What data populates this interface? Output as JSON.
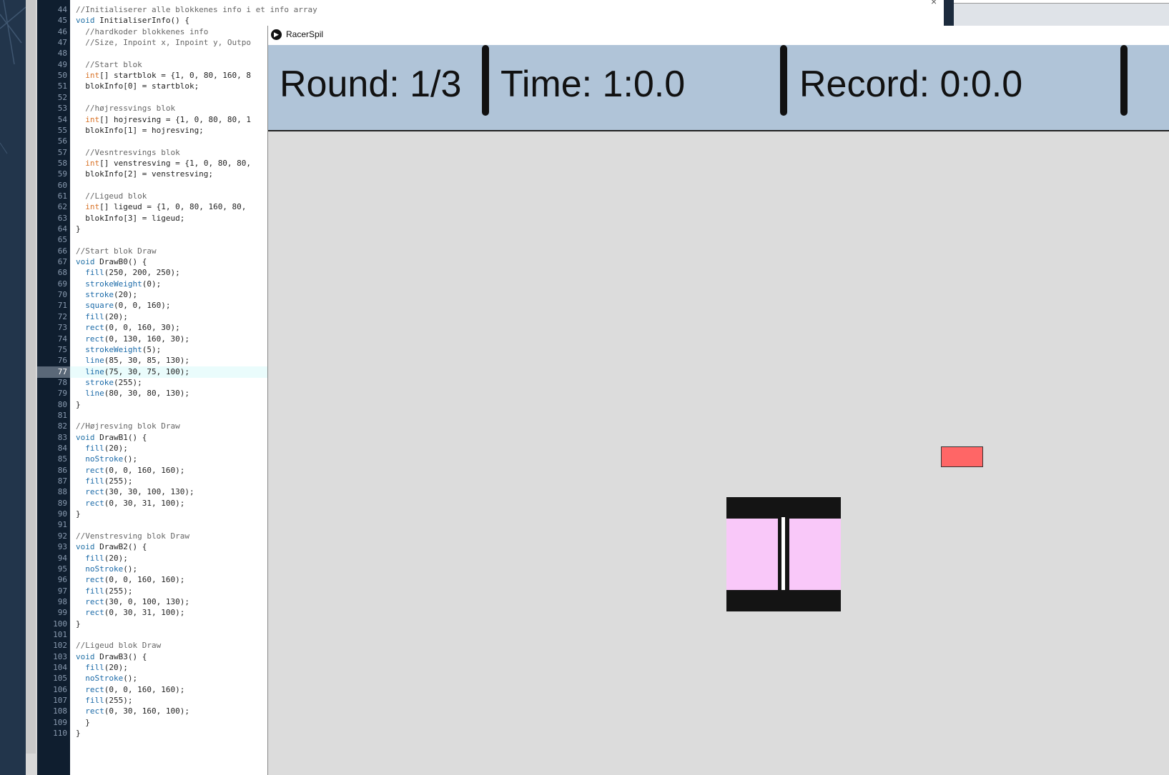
{
  "window": {
    "title": "RacerSpil"
  },
  "hud": {
    "round": "Round: 1/3",
    "time": "Time: 1:0.0",
    "record": "Record: 0:0.0"
  },
  "editor": {
    "active_line": 77,
    "lines": [
      {
        "n": "44",
        "code": "//Initialiserer alle blokkenes info i et info array"
      },
      {
        "n": "45",
        "code": "void InitialiserInfo() {"
      },
      {
        "n": "46",
        "code": "  //hardkoder blokkenes info"
      },
      {
        "n": "47",
        "code": "  //Size, Inpoint x, Inpoint y, Outpo"
      },
      {
        "n": "48",
        "code": ""
      },
      {
        "n": "49",
        "code": "  //Start blok"
      },
      {
        "n": "50",
        "code": "  int[] startblok = {1, 0, 80, 160, 8"
      },
      {
        "n": "51",
        "code": "  blokInfo[0] = startblok;"
      },
      {
        "n": "52",
        "code": ""
      },
      {
        "n": "53",
        "code": "  //højressvings blok"
      },
      {
        "n": "54",
        "code": "  int[] hojresving = {1, 0, 80, 80, 1"
      },
      {
        "n": "55",
        "code": "  blokInfo[1] = hojresving;"
      },
      {
        "n": "56",
        "code": ""
      },
      {
        "n": "57",
        "code": "  //Vesntresvings blok"
      },
      {
        "n": "58",
        "code": "  int[] venstresving = {1, 0, 80, 80,"
      },
      {
        "n": "59",
        "code": "  blokInfo[2] = venstresving;"
      },
      {
        "n": "60",
        "code": ""
      },
      {
        "n": "61",
        "code": "  //Ligeud blok"
      },
      {
        "n": "62",
        "code": "  int[] ligeud = {1, 0, 80, 160, 80,"
      },
      {
        "n": "63",
        "code": "  blokInfo[3] = ligeud;"
      },
      {
        "n": "64",
        "code": "}"
      },
      {
        "n": "65",
        "code": ""
      },
      {
        "n": "66",
        "code": "//Start blok Draw"
      },
      {
        "n": "67",
        "code": "void DrawB0() {"
      },
      {
        "n": "68",
        "code": "  fill(250, 200, 250);"
      },
      {
        "n": "69",
        "code": "  strokeWeight(0);"
      },
      {
        "n": "70",
        "code": "  stroke(20);"
      },
      {
        "n": "71",
        "code": "  square(0, 0, 160);"
      },
      {
        "n": "72",
        "code": "  fill(20);"
      },
      {
        "n": "73",
        "code": "  rect(0, 0, 160, 30);"
      },
      {
        "n": "74",
        "code": "  rect(0, 130, 160, 30);"
      },
      {
        "n": "75",
        "code": "  strokeWeight(5);"
      },
      {
        "n": "76",
        "code": "  line(85, 30, 85, 130);"
      },
      {
        "n": "77",
        "code": "  line(75, 30, 75, 100);"
      },
      {
        "n": "78",
        "code": "  stroke(255);"
      },
      {
        "n": "79",
        "code": "  line(80, 30, 80, 130);"
      },
      {
        "n": "80",
        "code": "}"
      },
      {
        "n": "81",
        "code": ""
      },
      {
        "n": "82",
        "code": "//Højresving blok Draw"
      },
      {
        "n": "83",
        "code": "void DrawB1() {"
      },
      {
        "n": "84",
        "code": "  fill(20);"
      },
      {
        "n": "85",
        "code": "  noStroke();"
      },
      {
        "n": "86",
        "code": "  rect(0, 0, 160, 160);"
      },
      {
        "n": "87",
        "code": "  fill(255);"
      },
      {
        "n": "88",
        "code": "  rect(30, 30, 100, 130);"
      },
      {
        "n": "89",
        "code": "  rect(0, 30, 31, 100);"
      },
      {
        "n": "90",
        "code": "}"
      },
      {
        "n": "91",
        "code": ""
      },
      {
        "n": "92",
        "code": "//Venstresving blok Draw"
      },
      {
        "n": "93",
        "code": "void DrawB2() {"
      },
      {
        "n": "94",
        "code": "  fill(20);"
      },
      {
        "n": "95",
        "code": "  noStroke();"
      },
      {
        "n": "96",
        "code": "  rect(0, 0, 160, 160);"
      },
      {
        "n": "97",
        "code": "  fill(255);"
      },
      {
        "n": "98",
        "code": "  rect(30, 0, 100, 130);"
      },
      {
        "n": "99",
        "code": "  rect(0, 30, 31, 100);"
      },
      {
        "n": "100",
        "code": "}"
      },
      {
        "n": "101",
        "code": ""
      },
      {
        "n": "102",
        "code": "//Ligeud blok Draw"
      },
      {
        "n": "103",
        "code": "void DrawB3() {"
      },
      {
        "n": "104",
        "code": "  fill(20);"
      },
      {
        "n": "105",
        "code": "  noStroke();"
      },
      {
        "n": "106",
        "code": "  rect(0, 0, 160, 160);"
      },
      {
        "n": "107",
        "code": "  fill(255);"
      },
      {
        "n": "108",
        "code": "  rect(0, 30, 160, 100);"
      },
      {
        "n": "109",
        "code": "  }"
      },
      {
        "n": "110",
        "code": "}"
      }
    ]
  },
  "colors": {
    "hud_bg": "#b0c4d8",
    "canvas_bg": "#dcdcdc",
    "car": "#ff6666",
    "block_dark": "#141414",
    "block_pink": "#f9c8f9"
  },
  "icons": {
    "app_icon": "play-icon",
    "close_icon": "close-icon"
  }
}
